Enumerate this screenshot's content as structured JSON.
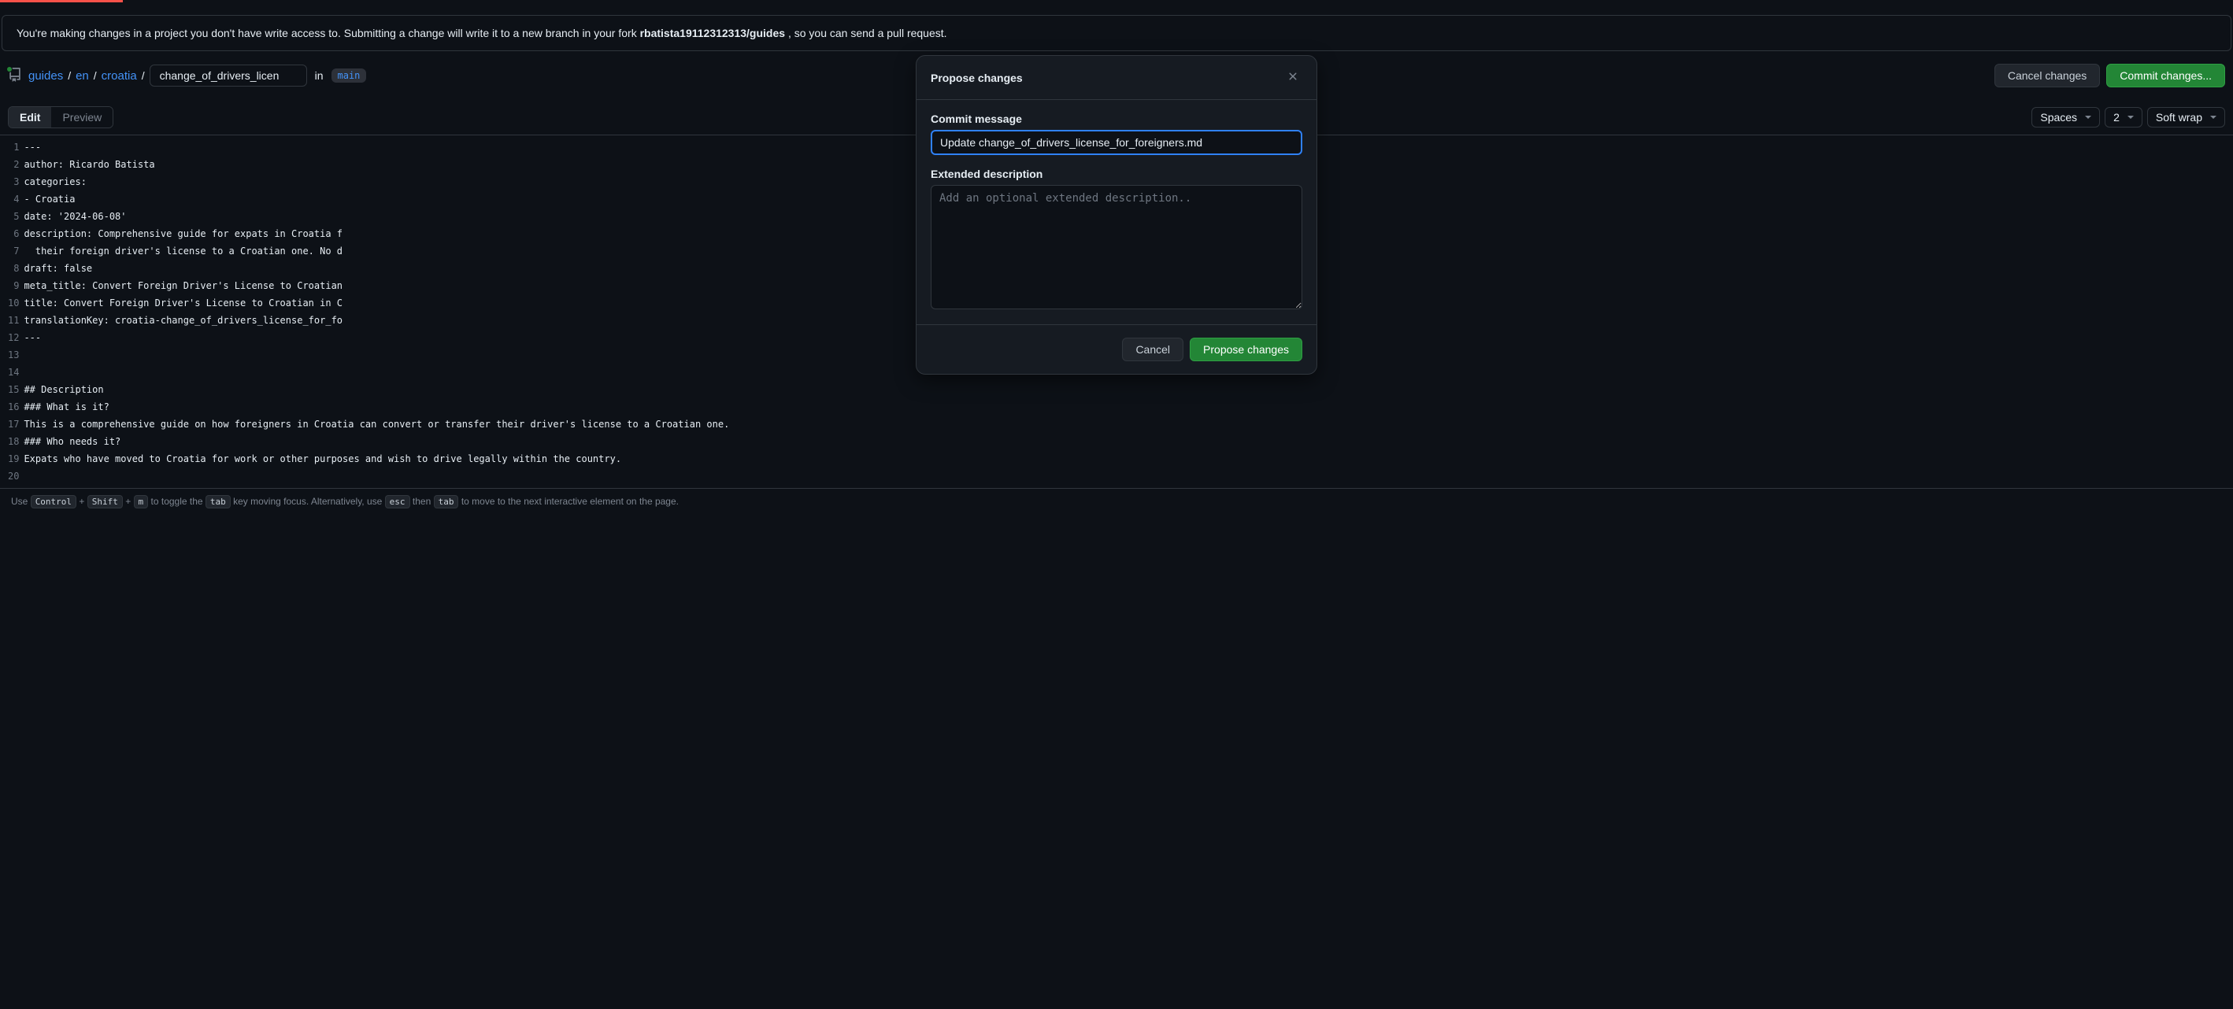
{
  "notice": {
    "prefix": "You're making changes in a project you don't have write access to. Submitting a change will write it to a new branch in your fork ",
    "repo": "rbatista19112312313/guides",
    "suffix": ", so you can send a pull request."
  },
  "breadcrumb": {
    "root": "guides",
    "seg1": "en",
    "seg2": "croatia",
    "filename": "change_of_drivers_licen",
    "in_label": "in",
    "branch": "main"
  },
  "path_actions": {
    "cancel": "Cancel changes",
    "commit": "Commit changes..."
  },
  "tabs": {
    "edit": "Edit",
    "preview": "Preview"
  },
  "selects": {
    "indent": "Spaces",
    "size": "2",
    "wrap": "Soft wrap"
  },
  "code_lines": [
    "---",
    "author: Ricardo Batista",
    "categories:",
    "- Croatia",
    "date: '2024-06-08'",
    "description: Comprehensive guide for expats in Croatia f",
    "  their foreign driver's license to a Croatian one. No d",
    "draft: false",
    "meta_title: Convert Foreign Driver's License to Croatian",
    "title: Convert Foreign Driver's License to Croatian in C",
    "translationKey: croatia-change_of_drivers_license_for_fo",
    "---",
    "",
    "",
    "## Description",
    "### What is it?",
    "This is a comprehensive guide on how foreigners in Croatia can convert or transfer their driver's license to a Croatian one.",
    "### Who needs it?",
    "Expats who have moved to Croatia for work or other purposes and wish to drive legally within the country.",
    ""
  ],
  "gutter": [
    "1",
    "2",
    "3",
    "4",
    "5",
    "6",
    "7",
    "8",
    "9",
    "10",
    "11",
    "12",
    "13",
    "14",
    "15",
    "16",
    "17",
    "18",
    "19",
    "20"
  ],
  "hint": {
    "p1": "Use ",
    "k1": "Control",
    "plus": " + ",
    "k2": "Shift",
    "k3": "m",
    "p2": " to toggle the ",
    "k4": "tab",
    "p3": " key moving focus. Alternatively, use ",
    "k5": "esc",
    "p4": " then ",
    "k6": "tab",
    "p5": " to move to the next interactive element on the page."
  },
  "modal": {
    "title": "Propose changes",
    "commit_message_label": "Commit message",
    "commit_message_value": "Update change_of_drivers_license_for_foreigners.md",
    "extended_label": "Extended description",
    "extended_placeholder": "Add an optional extended description..",
    "cancel": "Cancel",
    "submit": "Propose changes"
  }
}
